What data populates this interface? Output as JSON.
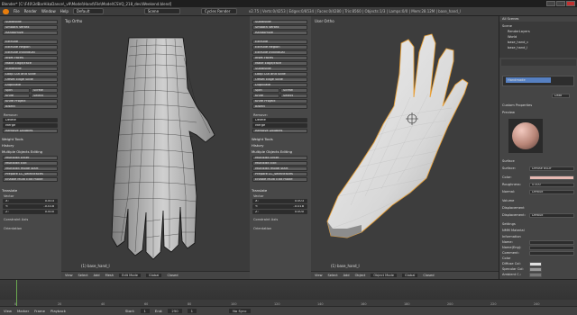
{
  "titlebar": {
    "title": "Blender* [C:\\F40\\3dBarHikaDance\\_v9\\Model\\Hand\\File\\Model\\CSVQ_218_dev\\Weekend.blend]"
  },
  "infobar": {
    "menus": [
      "File",
      "Render",
      "Window",
      "Help"
    ],
    "layout": "Default",
    "scene": "Scene",
    "engine": "Cycles Render",
    "stats": "v2.75 | Verts:0/4253 | Edges:0/8534 | Faces:0/4280 | Tris:8560 | Objects:1/3 | Lamps:0/0 | Mem:28.12M | base_hand_l"
  },
  "tool_left": {
    "buttons": [
      "Subdivide",
      "Smooth Vertex",
      "Randomize",
      "Extrude",
      "Extrude Region",
      "Extrude Individual",
      "Inset Faces",
      "Make Edge/Face",
      "Subdivide",
      "Loop Cut and Slide",
      "Offset Edge Slide",
      "Duplicate",
      "Spin",
      "Screw",
      "Knife",
      "Select",
      "Knife Project",
      "Bisect"
    ],
    "remove_label": "Remove:",
    "delete": "Delete",
    "merge": "Merge",
    "remove_doubles": "Remove Doubles",
    "weight_tools": "Weight Tools",
    "history": "History",
    "multi_edit": "Multiple Objects Editing",
    "multi_buttons": [
      "MultiEdit Enter",
      "MultiEdit Exit",
      "MultiEdit mode start",
      "Prepare LC_selectFaces",
      "Enable Multi Edit mode"
    ],
    "translate_head": "Translate",
    "vector_label": "Vector",
    "x": "X:",
    "xval": "0.003",
    "y": "Y:",
    "yval": "-0.018",
    "z": "Z:",
    "zval": "0.000",
    "constraint": "Constraint Axis",
    "orientation": "Orientation"
  },
  "vp_left": {
    "label": "Top Ortho",
    "object": "(1) base_hand_l",
    "header": [
      "View",
      "Select",
      "Add",
      "Mesh",
      "Edit Mode",
      "Global",
      "Closed"
    ]
  },
  "tool_mid": {
    "buttons": [
      "Subdivide",
      "Smooth Vertex",
      "Randomize",
      "Extrude",
      "Extrude Region",
      "Extrude Individual",
      "Inset Faces",
      "Make Edge/Face",
      "Subdivide",
      "Loop Cut and Slide",
      "Offset Edge Slide",
      "Duplicate",
      "Spin",
      "Screw",
      "Knife",
      "Select",
      "Knife Project",
      "Bisect"
    ],
    "remove_label": "Remove:",
    "delete": "Delete",
    "merge": "Merge",
    "remove_doubles": "Remove Doubles",
    "weight_tools": "Weight Tools",
    "history": "History",
    "multi_edit": "Multiple Objects Editing",
    "multi_buttons": [
      "MultiEdit Enter",
      "MultiEdit Exit",
      "MultiEdit mode start",
      "Prepare LC_selectFaces",
      "Enable Multi Edit mode"
    ],
    "translate_head": "Translate",
    "vector_label": "Vector",
    "x": "X:",
    "xval": "0.003",
    "y": "Y:",
    "yval": "-0.018",
    "z": "Z:",
    "zval": "0.000",
    "constraint": "Constraint Axis",
    "orientation": "Orientation"
  },
  "vp_right": {
    "label": "User Ortho",
    "object": "(1) base_hand_l",
    "header": [
      "View",
      "Select",
      "Add",
      "Object",
      "Object Mode",
      "Global",
      "Closed"
    ]
  },
  "outliner": {
    "header": "All Scenes",
    "items": [
      "Scene",
      "RenderLayers",
      "World",
      "base_hand_c",
      "base_hand_l"
    ]
  },
  "properties": {
    "material_name": "Handmade",
    "data_btn": "Data",
    "custom_props": "Custom Properties",
    "preview": "Preview",
    "surface": "Surface",
    "surface_label": "Surface:",
    "surface_val": "Diffuse BSDF",
    "color_label": "Color:",
    "roughness_label": "Roughness:",
    "roughness_val": "0.000",
    "normal_label": "Normal:",
    "normal_val": "Default",
    "volume": "Volume",
    "displacement": "Displacement",
    "displace_label": "Displacement:",
    "displace_val": "Default",
    "settings": "Settings",
    "nmm": "NMM Material",
    "information": "Information",
    "name_label": "Name:",
    "nameeng_label": "Name(Eng):",
    "comment_label": "Comment:",
    "color_head": "Color",
    "diffuse_label": "Diffuse Col:",
    "specular_label": "Specular Col:",
    "ambient_label": "Ambient C.:",
    "reflect_label": "Reflect:",
    "reflect_val": "0.000",
    "alpha_label": "Alpha:",
    "alpha_val": "1.000",
    "double_sided": "Double Sided",
    "ground_shadow": "Ground Shadow"
  },
  "timeline": {
    "menus": [
      "View",
      "Marker",
      "Frame",
      "Playback"
    ],
    "start_label": "Start:",
    "start": "1",
    "end_label": "End:",
    "end": "250",
    "current": "1",
    "sync": "No Sync",
    "ticks": [
      "0",
      "20",
      "40",
      "60",
      "80",
      "100",
      "120",
      "140",
      "160",
      "180",
      "200",
      "220",
      "240"
    ]
  }
}
